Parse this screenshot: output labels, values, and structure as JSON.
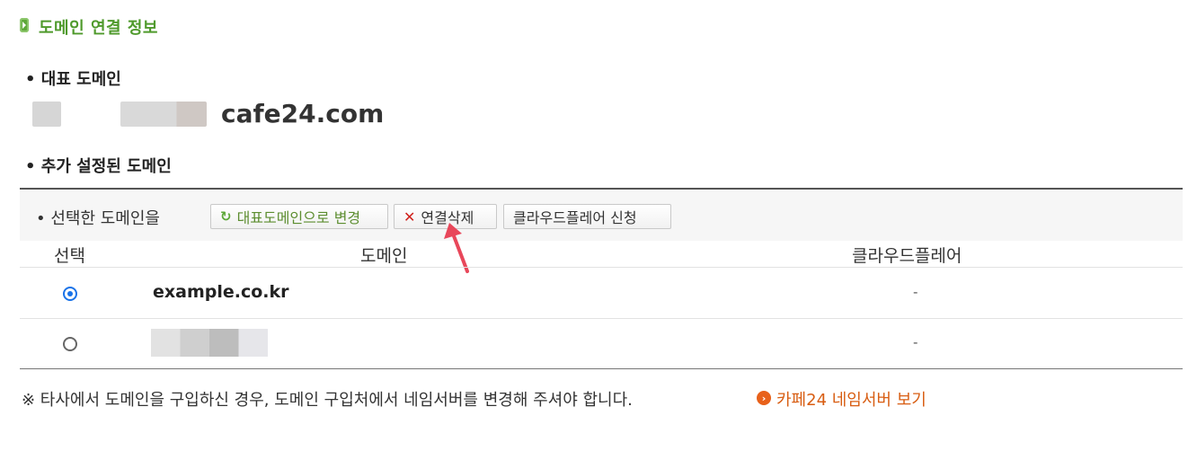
{
  "section": {
    "title": "도메인 연결 정보",
    "icon": "green-tab-icon"
  },
  "primary": {
    "heading": "대표 도메인",
    "domain_suffix": "cafe24.com"
  },
  "additional": {
    "heading": "추가 설정된 도메인"
  },
  "actions": {
    "label": "선택한 도메인을",
    "set_primary": "대표도메인으로 변경",
    "delete": "연결삭제",
    "cloudflare": "클라우드플레어 신청"
  },
  "table": {
    "headers": [
      "선택",
      "도메인",
      "클라우드플레어"
    ],
    "rows": [
      {
        "selected": true,
        "domain": "example.co.kr",
        "cloudflare": "-"
      },
      {
        "selected": false,
        "domain": "",
        "cloudflare": "-"
      }
    ]
  },
  "note": {
    "text": "※ 타사에서 도메인을 구입하신 경우, 도메인 구입처에서 네임서버를 변경해 주셔야 합니다.",
    "link": "카페24 네임서버 보기"
  },
  "colors": {
    "accent_green": "#4f9a2c",
    "danger_red": "#d0211c",
    "link_orange": "#d85d12",
    "radio_blue": "#1a73e8"
  }
}
